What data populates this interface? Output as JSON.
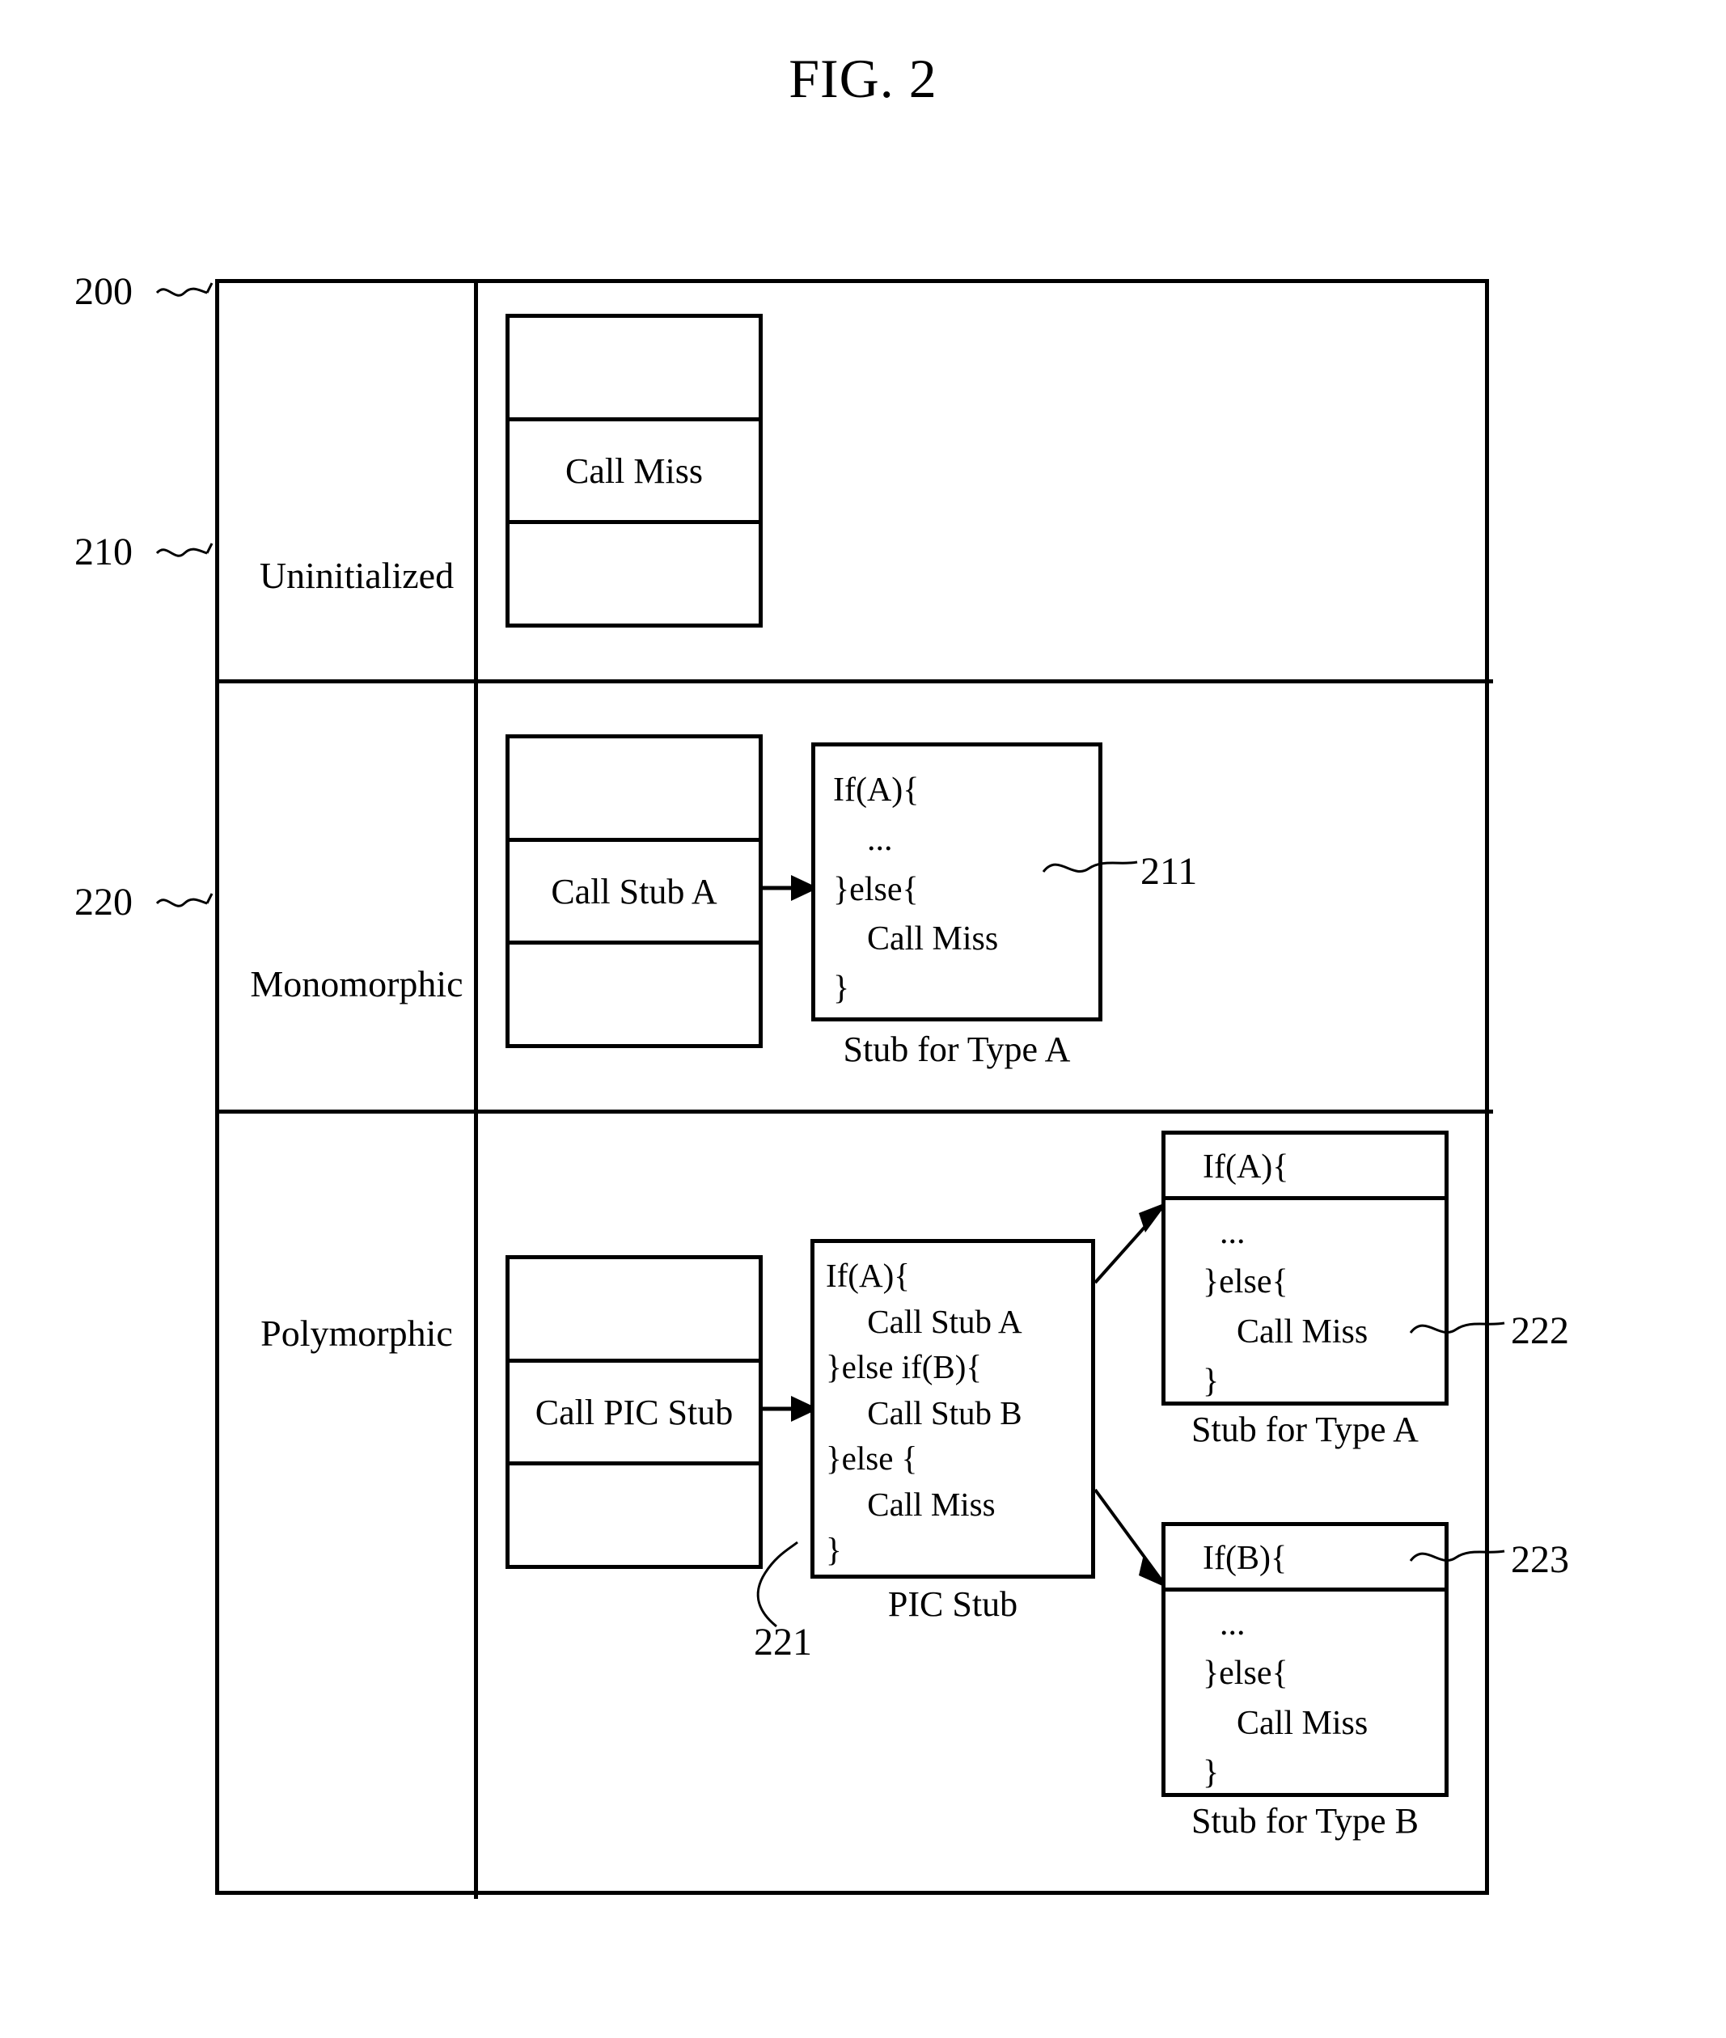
{
  "figure": {
    "title": "FIG. 2"
  },
  "table": {
    "rows": [
      {
        "ref": "200",
        "state_label": "Uninitialized",
        "callsite": {
          "cells": [
            "",
            "Call Miss",
            ""
          ]
        },
        "stubs": []
      },
      {
        "ref": "210",
        "state_label": "Monomorphic",
        "callsite": {
          "cells": [
            "",
            "Call Stub A",
            ""
          ]
        },
        "stubs": [
          {
            "ref": "211",
            "caption": "Stub for Type A",
            "code": "If(A){\n    ...\n}else{\n    Call Miss\n}"
          }
        ]
      },
      {
        "ref": "220",
        "state_label": "Polymorphic",
        "callsite": {
          "cells": [
            "",
            "Call PIC Stub",
            ""
          ]
        },
        "stubs": [
          {
            "ref": "221",
            "caption": "PIC Stub",
            "code": "If(A){\n     Call Stub A\n}else if(B){\n     Call Stub B\n}else {\n     Call Miss\n}"
          },
          {
            "ref": "222",
            "caption": "Stub for Type A",
            "head": "If(A){",
            "code": "  ...\n}else{\n    Call Miss\n}"
          },
          {
            "ref": "223",
            "caption": "Stub for Type B",
            "head": "If(B){",
            "code": "  ...\n}else{\n    Call Miss\n}"
          }
        ]
      }
    ]
  },
  "colors": {
    "line": "#000000",
    "background": "#ffffff"
  }
}
